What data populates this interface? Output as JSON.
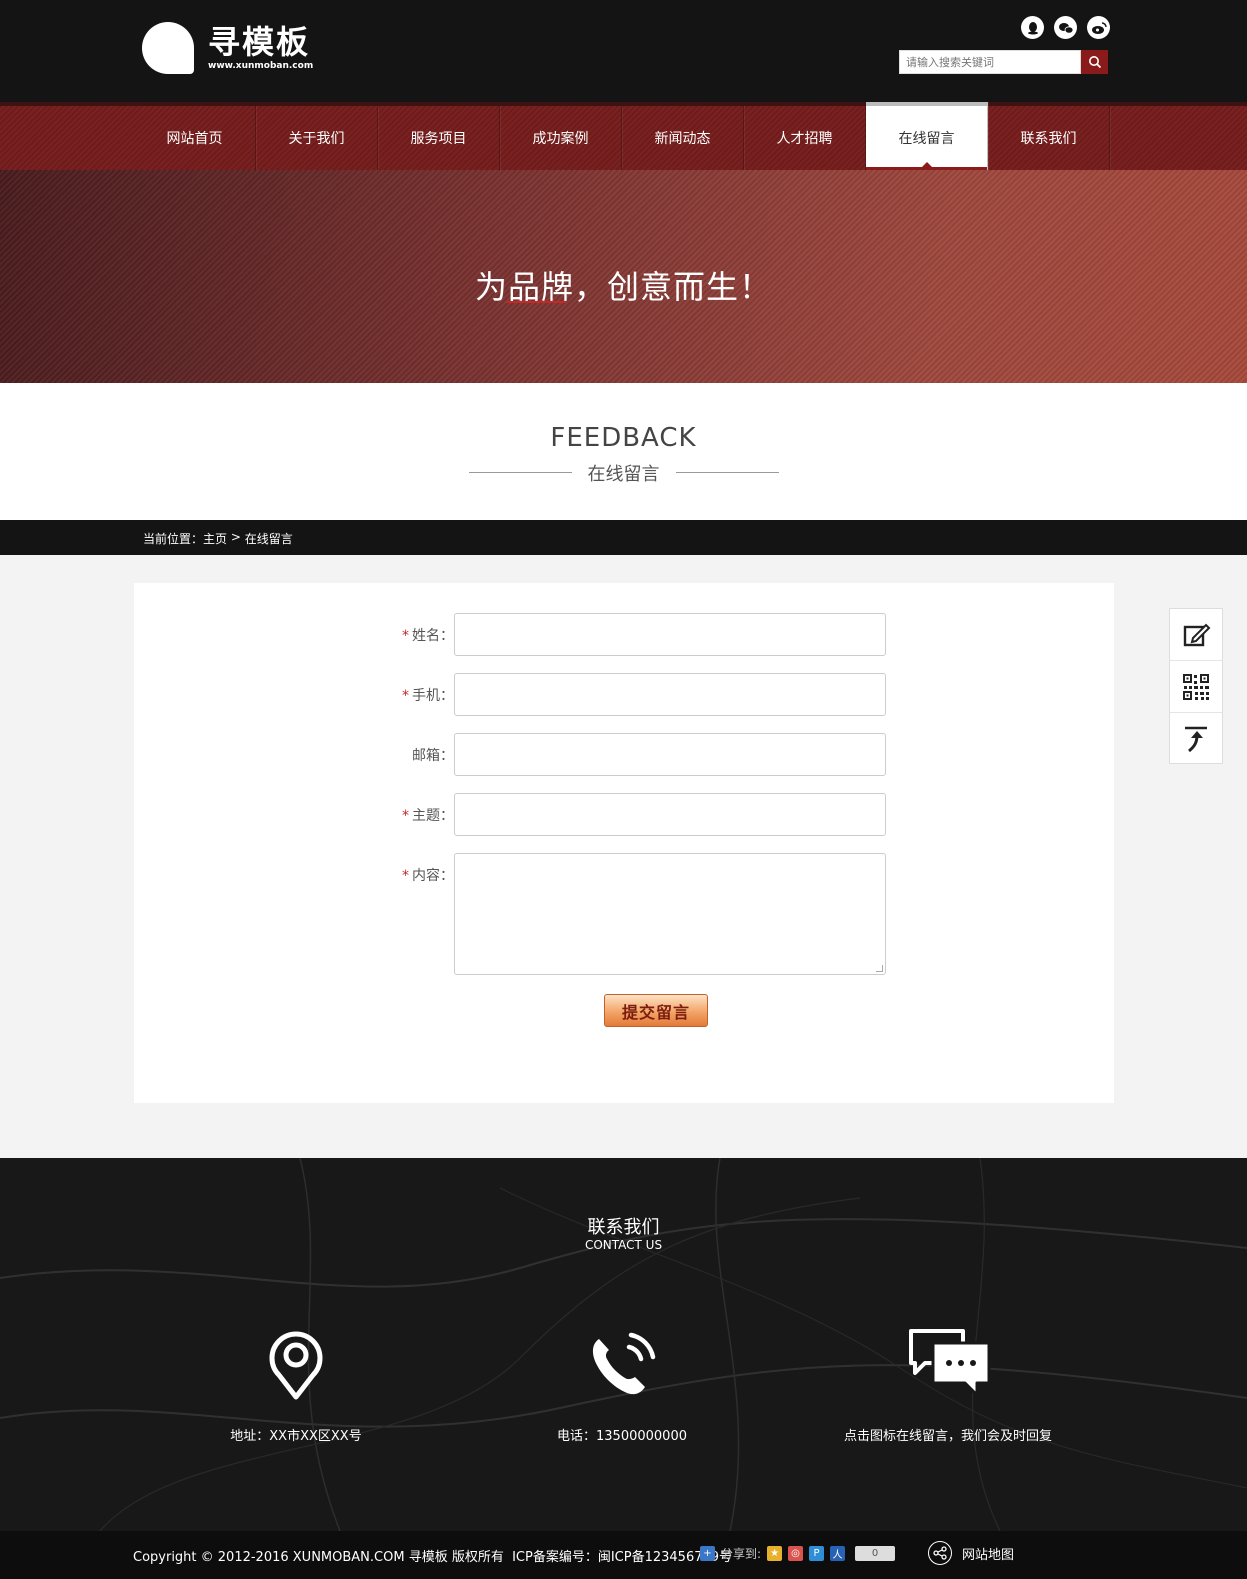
{
  "brand": {
    "name": "寻模板",
    "url": "www.xunmoban.com"
  },
  "search": {
    "placeholder": "请输入搜索关键词"
  },
  "nav": {
    "items": [
      "网站首页",
      "关于我们",
      "服务项目",
      "成功案例",
      "新闻动态",
      "人才招聘",
      "在线留言",
      "联系我们"
    ],
    "active_index": 6
  },
  "banner": {
    "slogan": "为品牌，创意而生！"
  },
  "section": {
    "title_en": "FEEDBACK",
    "title_cn": "在线留言"
  },
  "breadcrumb": {
    "prefix": "当前位置：",
    "home": "主页",
    "separator": " > ",
    "current": "在线留言"
  },
  "form": {
    "fields": [
      {
        "label": "姓名：",
        "required": true,
        "value": ""
      },
      {
        "label": "手机：",
        "required": true,
        "value": ""
      },
      {
        "label": "邮箱：",
        "required": false,
        "value": ""
      },
      {
        "label": "主题：",
        "required": true,
        "value": ""
      },
      {
        "label": "内容：",
        "required": true,
        "value": ""
      }
    ],
    "required_mark": "*",
    "submit_label": "提交留言"
  },
  "contact": {
    "title": "联系我们",
    "subtitle": "CONTACT US",
    "address": "地址：XX市XX区XX号",
    "phone": "电话：13500000000",
    "message": "点击图标在线留言，我们会及时回复"
  },
  "footer": {
    "copyright": "Copyright © 2012-2016 XUNMOBAN.COM 寻模板 版权所有  ICP备案编号：闽ICP备123456789号",
    "share_label": "分享到:",
    "share_count": "0",
    "sitemap_label": "网站地图"
  },
  "colors": {
    "brand_red": "#8b1a1a",
    "header_bg": "#141414",
    "required": "#c62828"
  }
}
